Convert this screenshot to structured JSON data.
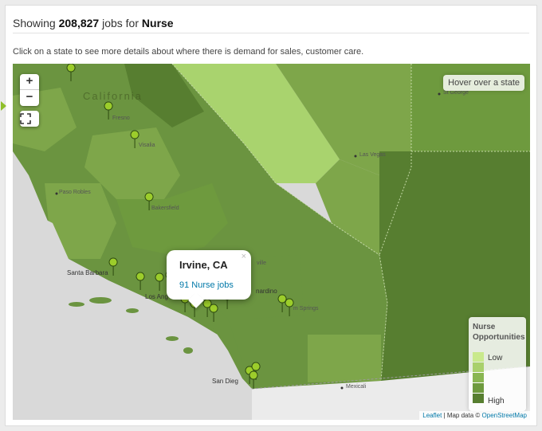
{
  "header": {
    "prefix": "Showing",
    "count": "208,827",
    "middle": "jobs for",
    "keyword": "Nurse"
  },
  "instructions": "Click on a state to see more details about where there is demand for sales, customer care.",
  "map": {
    "zoom_in": "+",
    "zoom_out": "−",
    "hover_box": "Hover over a state",
    "labels": {
      "california": "California",
      "fresno": "Fresno",
      "visalia": "Visalia",
      "paso_robles": "Paso Robles",
      "bakersfield": "Bakersfield",
      "santa_barbara": "Santa Barbara",
      "los_angeles": "Los Ang",
      "victorville": "ville",
      "san_bernardino": "nardino",
      "palm_springs": "m Springs",
      "san_diego": "San Dieg",
      "mexicali": "Mexicali",
      "las_vegas": "Las Vegas",
      "st_george": "St George"
    },
    "popup": {
      "title": "Irvine, CA",
      "link": "91 Nurse jobs",
      "close": "×"
    },
    "legend": {
      "title_line1": "Nurse",
      "title_line2": "Opportunities",
      "low": "Low",
      "high": "High",
      "colors": [
        "#c9e98c",
        "#a9d06b",
        "#8ab652",
        "#6e9a3e",
        "#577e30"
      ]
    },
    "attribution": {
      "leaflet": "Leaflet",
      "sep": " | Map data © ",
      "osm": "OpenStreetMap"
    },
    "colors": {
      "dark": "#577e30",
      "mid_dark": "#6b9440",
      "mid": "#7ea64a",
      "light": "#9ac867",
      "lightest": "#a9d36e",
      "ocean": "#d9d9d9",
      "land_outside": "#ebebeb",
      "marker": "#9ccd2b"
    },
    "marker_icon": "map-pin-icon"
  }
}
